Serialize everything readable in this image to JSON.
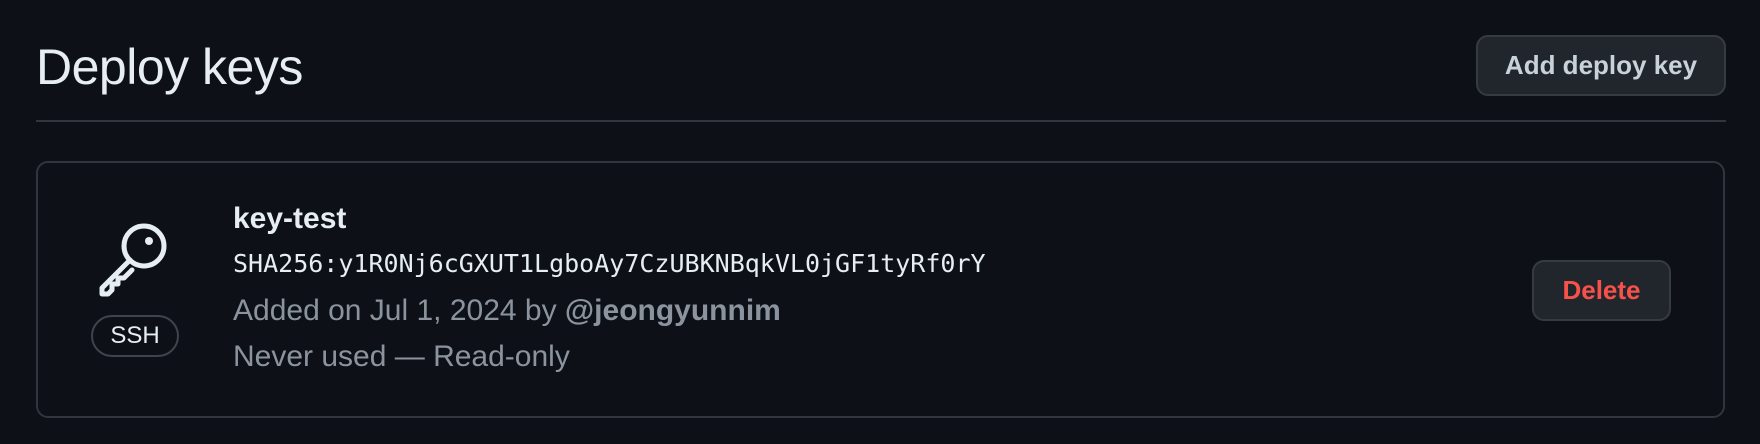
{
  "header": {
    "title": "Deploy keys",
    "add_button_label": "Add deploy key"
  },
  "key": {
    "icon": "key-icon",
    "type_badge": "SSH",
    "title": "key-test",
    "fingerprint": "SHA256:y1R0Nj6cGXUT1LgboAy7CzUBKNBqkVL0jGF1tyRf0rY",
    "added_prefix": "Added on Jul 1, 2024 by ",
    "added_by": "@jeongyunnim",
    "usage": "Never used — Read-only",
    "delete_label": "Delete"
  },
  "colors": {
    "background": "#0d1117",
    "border": "#30363d",
    "text_primary": "#e6edf3",
    "text_muted": "#8b949e",
    "danger": "#f85149",
    "button_bg": "#21262d"
  }
}
